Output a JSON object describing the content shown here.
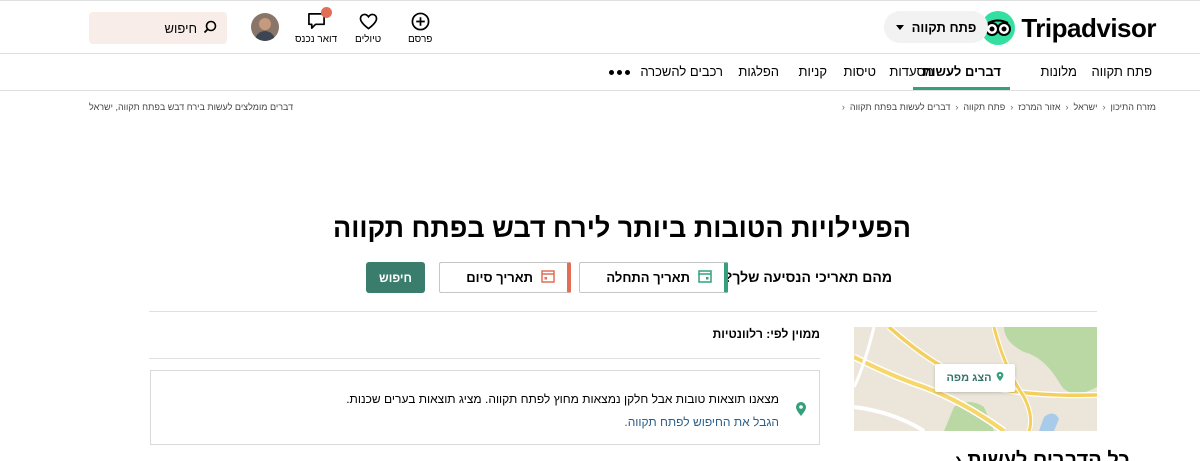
{
  "header": {
    "brand": "Tripadvisor",
    "geo_button": "פתח תקווה",
    "items": [
      {
        "label": "פרסם",
        "icon": "plus-circle-icon"
      },
      {
        "label": "טיולים",
        "icon": "heart-icon"
      },
      {
        "label": "דואר נכנס",
        "icon": "chat-bubble-icon"
      }
    ],
    "search_placeholder": "חיפוש",
    "colors": {
      "brand_green": "#34e0a1",
      "accent_green": "#34a07c",
      "accent_coral": "#e26e55"
    }
  },
  "nav": {
    "items": [
      {
        "label": "פתח תקווה"
      },
      {
        "label": "מלונות"
      },
      {
        "label": "דברים לעשות",
        "active": true
      },
      {
        "label": "מסעדות"
      },
      {
        "label": "טיסות"
      },
      {
        "label": "קניות"
      },
      {
        "label": "הפלגות"
      },
      {
        "label": "רכבים להשכרה"
      }
    ]
  },
  "breadcrumbs": [
    "מזרח התיכון",
    "ישראל",
    "אזור המרכז",
    "פתח תקווה",
    "דברים לעשות בפתח תקווה"
  ],
  "breadcrumb_left": "דברים מומלצים לעשות בירח דבש בפתח תקווה, ישראל",
  "page_title": "הפעילויות הטובות ביותר לירח דבש בפתח תקווה",
  "dates": {
    "question": "מהם תאריכי הנסיעה שלך?",
    "start_label": "תאריך התחלה",
    "end_label": "תאריך סיום",
    "search_button": "חיפוש"
  },
  "sort": {
    "label": "ממוין לפי: רלוונטיות"
  },
  "info": {
    "text": "מצאנו תוצאות טובות אבל חלקן נמצאות מחוץ לפתח תקווה. מציג תוצאות בערים שכנות.",
    "link": "הגבל את החיפוש לפתח תקווה."
  },
  "map": {
    "button": "הצג מפה"
  },
  "sidebar": {
    "title": "כל הדברים לעשות"
  }
}
